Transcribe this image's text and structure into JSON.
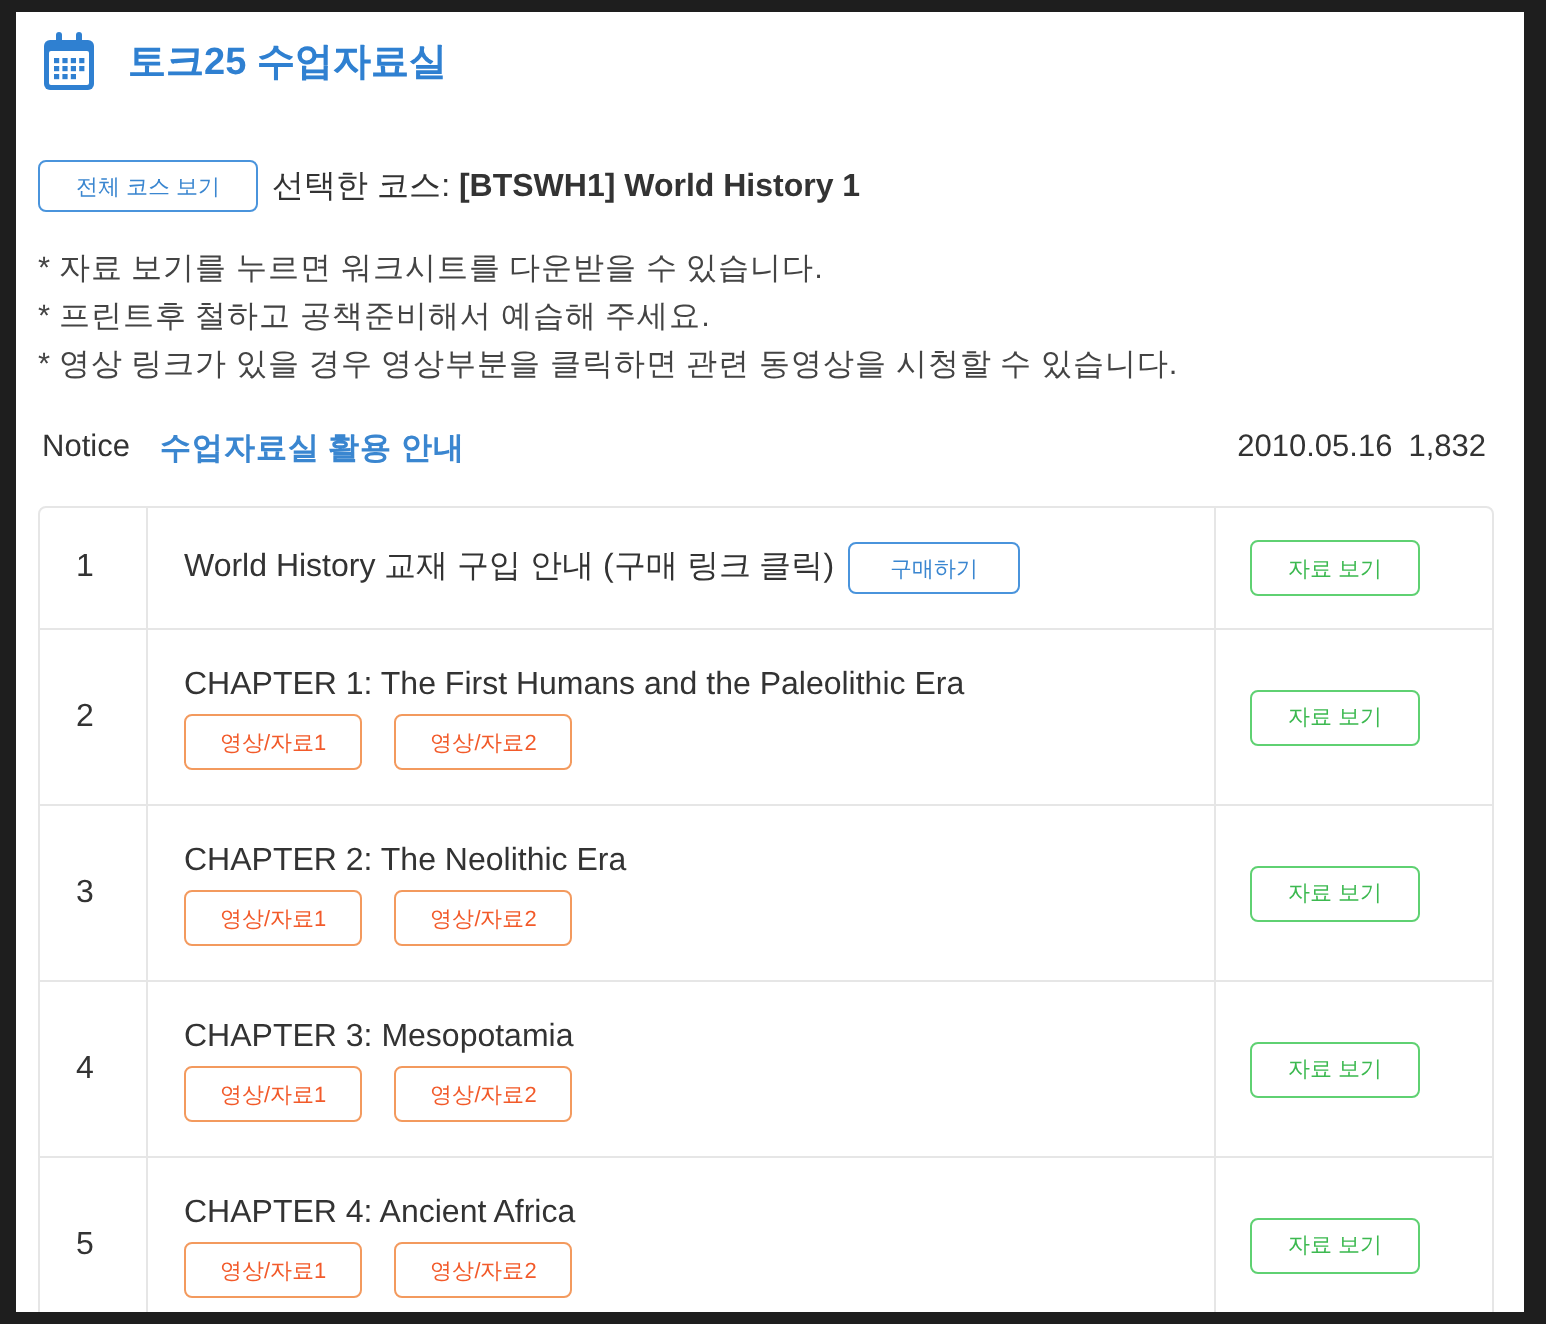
{
  "header": {
    "title": "토크25 수업자료실"
  },
  "course": {
    "button": "전체 코스 보기",
    "text": "선택한 코스: **[BTSWH1] World History 1**"
  },
  "notes": [
    "* 자료 보기를 누르면 워크시트를 다운받을 수 있습니다.",
    "* 프린트후 철하고 공책준비해서 예습해 주세요.",
    "* 영상 링크가 있을 경우 영상부분을 클릭하면 관련 동영상을 시청할 수 있습니다."
  ],
  "notice": {
    "tag": "Notice",
    "title": "수업자료실 활용 안내",
    "date": "2010.05.16",
    "views": "1,832"
  },
  "rows": [
    {
      "kind": "purchase",
      "number": "1",
      "title": "World History 교재 구입 안내 (구매 링크 클릭)",
      "purchase_button": "구매하기",
      "action": "자료 보기"
    },
    {
      "kind": "chapter",
      "number": "2",
      "title": "CHAPTER 1: The First Humans and the Paleolithic Era",
      "links": [
        "영상/자료1",
        "영상/자료2"
      ],
      "action": "자료 보기"
    },
    {
      "kind": "chapter",
      "number": "3",
      "title": "CHAPTER 2: The Neolithic Era",
      "links": [
        "영상/자료1",
        "영상/자료2"
      ],
      "action": "자료 보기"
    },
    {
      "kind": "chapter",
      "number": "4",
      "title": "CHAPTER 3: Mesopotamia",
      "links": [
        "영상/자료1",
        "영상/자료2"
      ],
      "action": "자료 보기"
    },
    {
      "kind": "chapter",
      "number": "5",
      "title": "CHAPTER 4: Ancient Africa",
      "links": [
        "영상/자료1",
        "영상/자료2"
      ],
      "action": "자료 보기"
    }
  ]
}
